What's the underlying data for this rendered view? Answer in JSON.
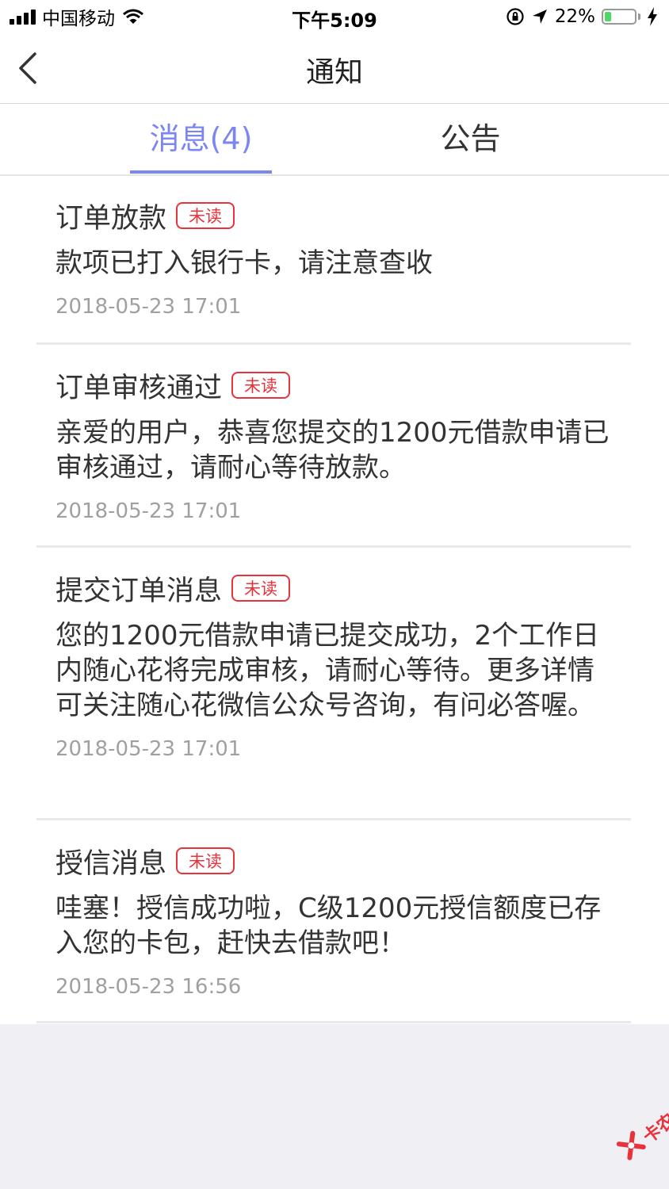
{
  "status_bar": {
    "carrier": "中国移动",
    "time": "下午5:09",
    "battery_percent": "22%",
    "battery_level": 0.22
  },
  "nav": {
    "title": "通知"
  },
  "tabs": [
    {
      "label": "消息(4)",
      "active": true
    },
    {
      "label": "公告",
      "active": false
    }
  ],
  "messages": [
    {
      "title": "订单放款",
      "badge": "未读",
      "body": "款项已打入银行卡，请注意查收",
      "time": "2018-05-23 17:01"
    },
    {
      "title": "订单审核通过",
      "badge": "未读",
      "body": "亲爱的用户，恭喜您提交的1200元借款申请已审核通过，请耐心等待放款。",
      "time": "2018-05-23 17:01"
    },
    {
      "title": "提交订单消息",
      "badge": "未读",
      "body": "您的1200元借款申请已提交成功，2个工作日内随心花将完成审核，请耐心等待。更多详情可关注随心花微信公众号咨询，有问必答喔。",
      "time": "2018-05-23 17:01"
    },
    {
      "title": "授信消息",
      "badge": "未读",
      "body": "哇塞！授信成功啦，C级1200元授信额度已存入您的卡包，赶快去借款吧！",
      "time": "2018-05-23 16:56"
    }
  ],
  "watermark": {
    "text": "卡农社区"
  },
  "colors": {
    "accent": "#7b86f0",
    "unread": "#e8323c",
    "background": "#efeff4",
    "battery": "#4cd964"
  }
}
